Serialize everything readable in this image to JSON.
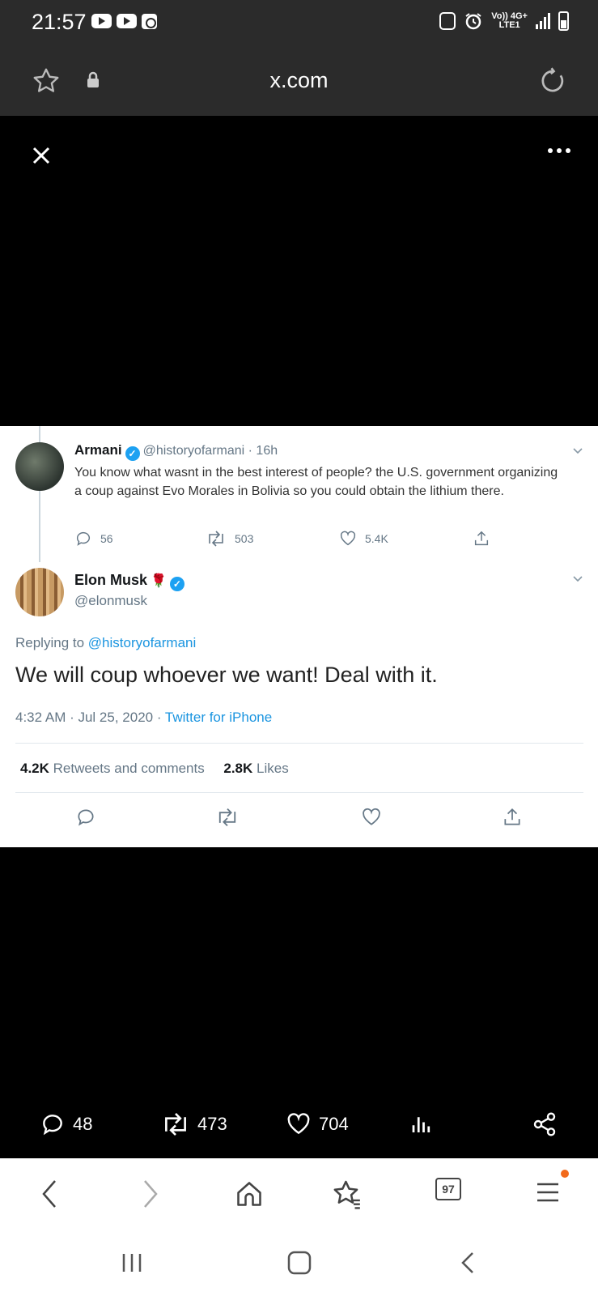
{
  "status_bar": {
    "time": "21:57",
    "network_label_top": "Vo)) 4G+",
    "network_label_bottom": "LTE1"
  },
  "url_bar": {
    "domain": "x.com"
  },
  "tweet_screenshot": {
    "parent": {
      "name": "Armani",
      "handle_time": "@historyofarmani · 16h",
      "text": "You know what wasnt in the best interest of people? the U.S. government organizing a coup against Evo Morales in Bolivia so you could obtain the lithium there.",
      "replies": "56",
      "retweets": "503",
      "likes": "5.4K"
    },
    "main": {
      "name": "Elon Musk",
      "handle": "@elonmusk",
      "replying_prefix": "Replying to ",
      "replying_handle": "@historyofarmani",
      "text": "We will coup whoever we want! Deal with it.",
      "timestamp": "4:32 AM · Jul 25, 2020 · ",
      "source": "Twitter for iPhone",
      "retweets_count": "4.2K",
      "retweets_label": "Retweets and comments",
      "likes_count": "2.8K",
      "likes_label": "Likes"
    }
  },
  "post_stats": {
    "replies": "48",
    "reposts": "473",
    "likes": "704"
  },
  "browser_toolbar": {
    "tab_count": "97"
  }
}
